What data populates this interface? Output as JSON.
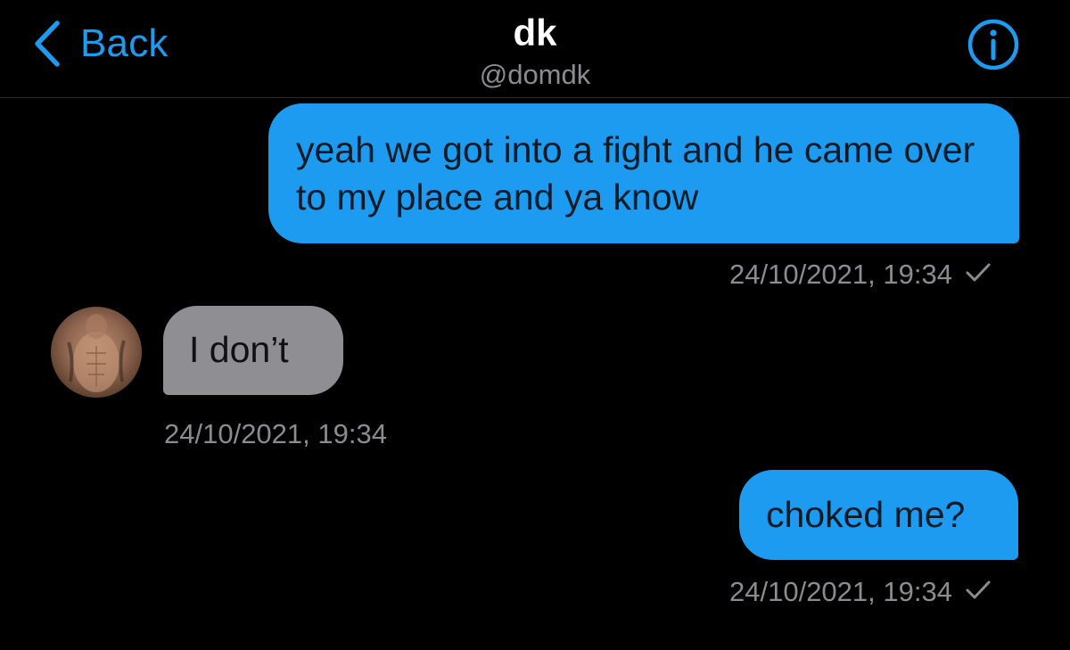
{
  "header": {
    "back_label": "Back",
    "title": "dk",
    "handle": "@domdk"
  },
  "icons": {
    "back": "chevron-left-icon",
    "info": "info-icon",
    "read_receipt": "checkmark-icon"
  },
  "colors": {
    "accent": "#1d9bf0",
    "incoming_bubble": "#8e8e93",
    "background": "#000000",
    "meta_text": "#8b8b90"
  },
  "messages": [
    {
      "direction": "outgoing",
      "text": "yeah we got into a fight and he came over to my place and ya know",
      "timestamp": "24/10/2021, 19:34",
      "read": true
    },
    {
      "direction": "incoming",
      "text": "I don’t",
      "timestamp": "24/10/2021, 19:34"
    },
    {
      "direction": "outgoing",
      "text": "choked me?",
      "timestamp": "24/10/2021, 19:34",
      "read": true
    }
  ]
}
